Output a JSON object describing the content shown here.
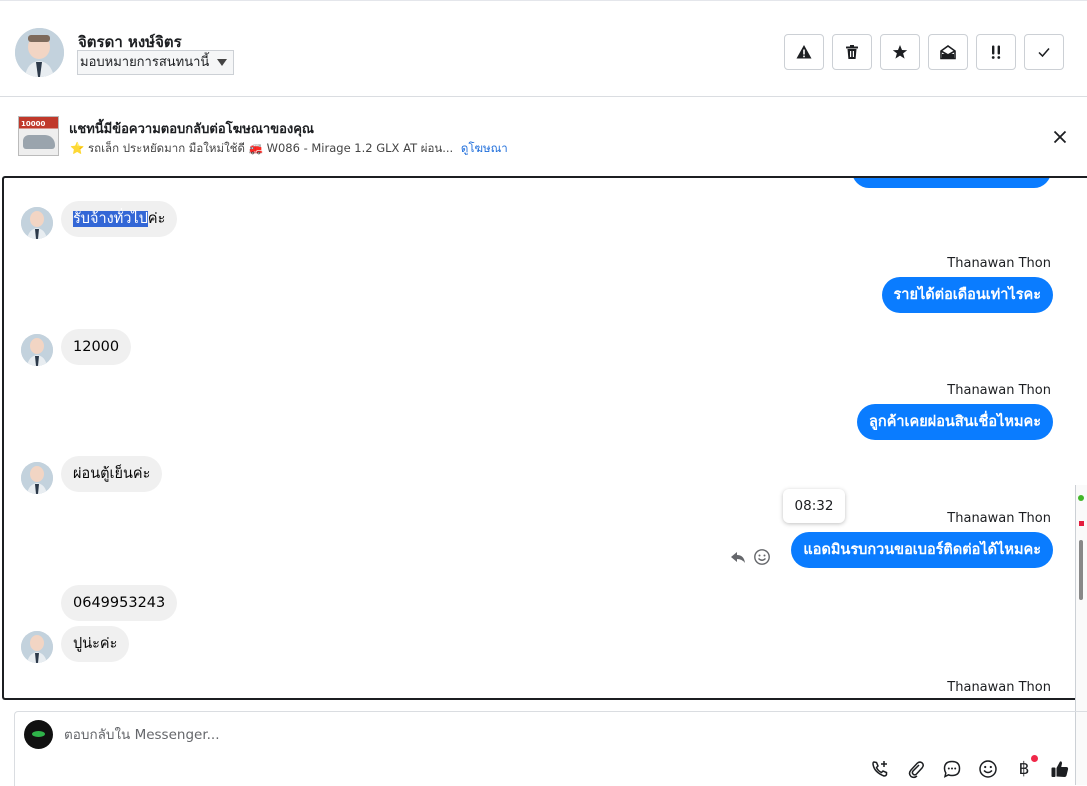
{
  "header": {
    "contact_name": "จิตรดา หงษ์จิตร",
    "assign_label": "มอบหมายการสนทนานี้",
    "toolbar": {
      "spam_icon": "warning-icon",
      "delete_icon": "trash-icon",
      "star_icon": "star-icon",
      "unread_icon": "envelope-open-icon",
      "follow_up_icon": "double-exclamation-icon",
      "done_icon": "check-icon"
    }
  },
  "ad_banner": {
    "title": "แชทนี้มีข้อความตอบกลับต่อโฆษณาของคุณ",
    "description": "⭐ รถเล็ก ประหยัดมาก มือใหม่ใช้ดี 🚒 W086 - Mirage 1.2 GLX AT ผ่อน...",
    "thumb_text": "10000",
    "link": "ดูโฆษณา"
  },
  "messages": [
    {
      "side": "in",
      "text_highlighted": "รับจ้างทั่วไป",
      "text_rest": "ค่ะ"
    },
    {
      "side": "out",
      "sender": "Thanawan Thon",
      "text": "รายได้ต่อเดือนเท่าไรคะ"
    },
    {
      "side": "in",
      "text": "12000"
    },
    {
      "side": "out",
      "sender": "Thanawan Thon",
      "text": "ลูกค้าเคยผ่อนสินเชื่อไหมคะ"
    },
    {
      "side": "in",
      "text": "ผ่อนตู้เย็นค่ะ"
    },
    {
      "side": "out",
      "sender": "Thanawan Thon",
      "text": "แอดมินรบกวนขอเบอร์ติดต่อได้ไหมคะ",
      "time": "08:32"
    },
    {
      "side": "in",
      "text": "0649953243"
    },
    {
      "side": "in",
      "text": "ปูน่ะค่ะ"
    },
    {
      "side": "out",
      "sender": "Thanawan Thon"
    }
  ],
  "composer": {
    "placeholder": "ตอบกลับใน Messenger...",
    "icons": [
      "phone-plus-icon",
      "paperclip-icon",
      "chat-bubble-icon",
      "emoji-icon",
      "baht-icon",
      "thumbs-up-icon"
    ],
    "baht_symbol": "฿"
  },
  "colors": {
    "outgoing_bubble": "#0a7cff",
    "incoming_bubble": "#f0f0f0",
    "link": "#216fdb"
  }
}
